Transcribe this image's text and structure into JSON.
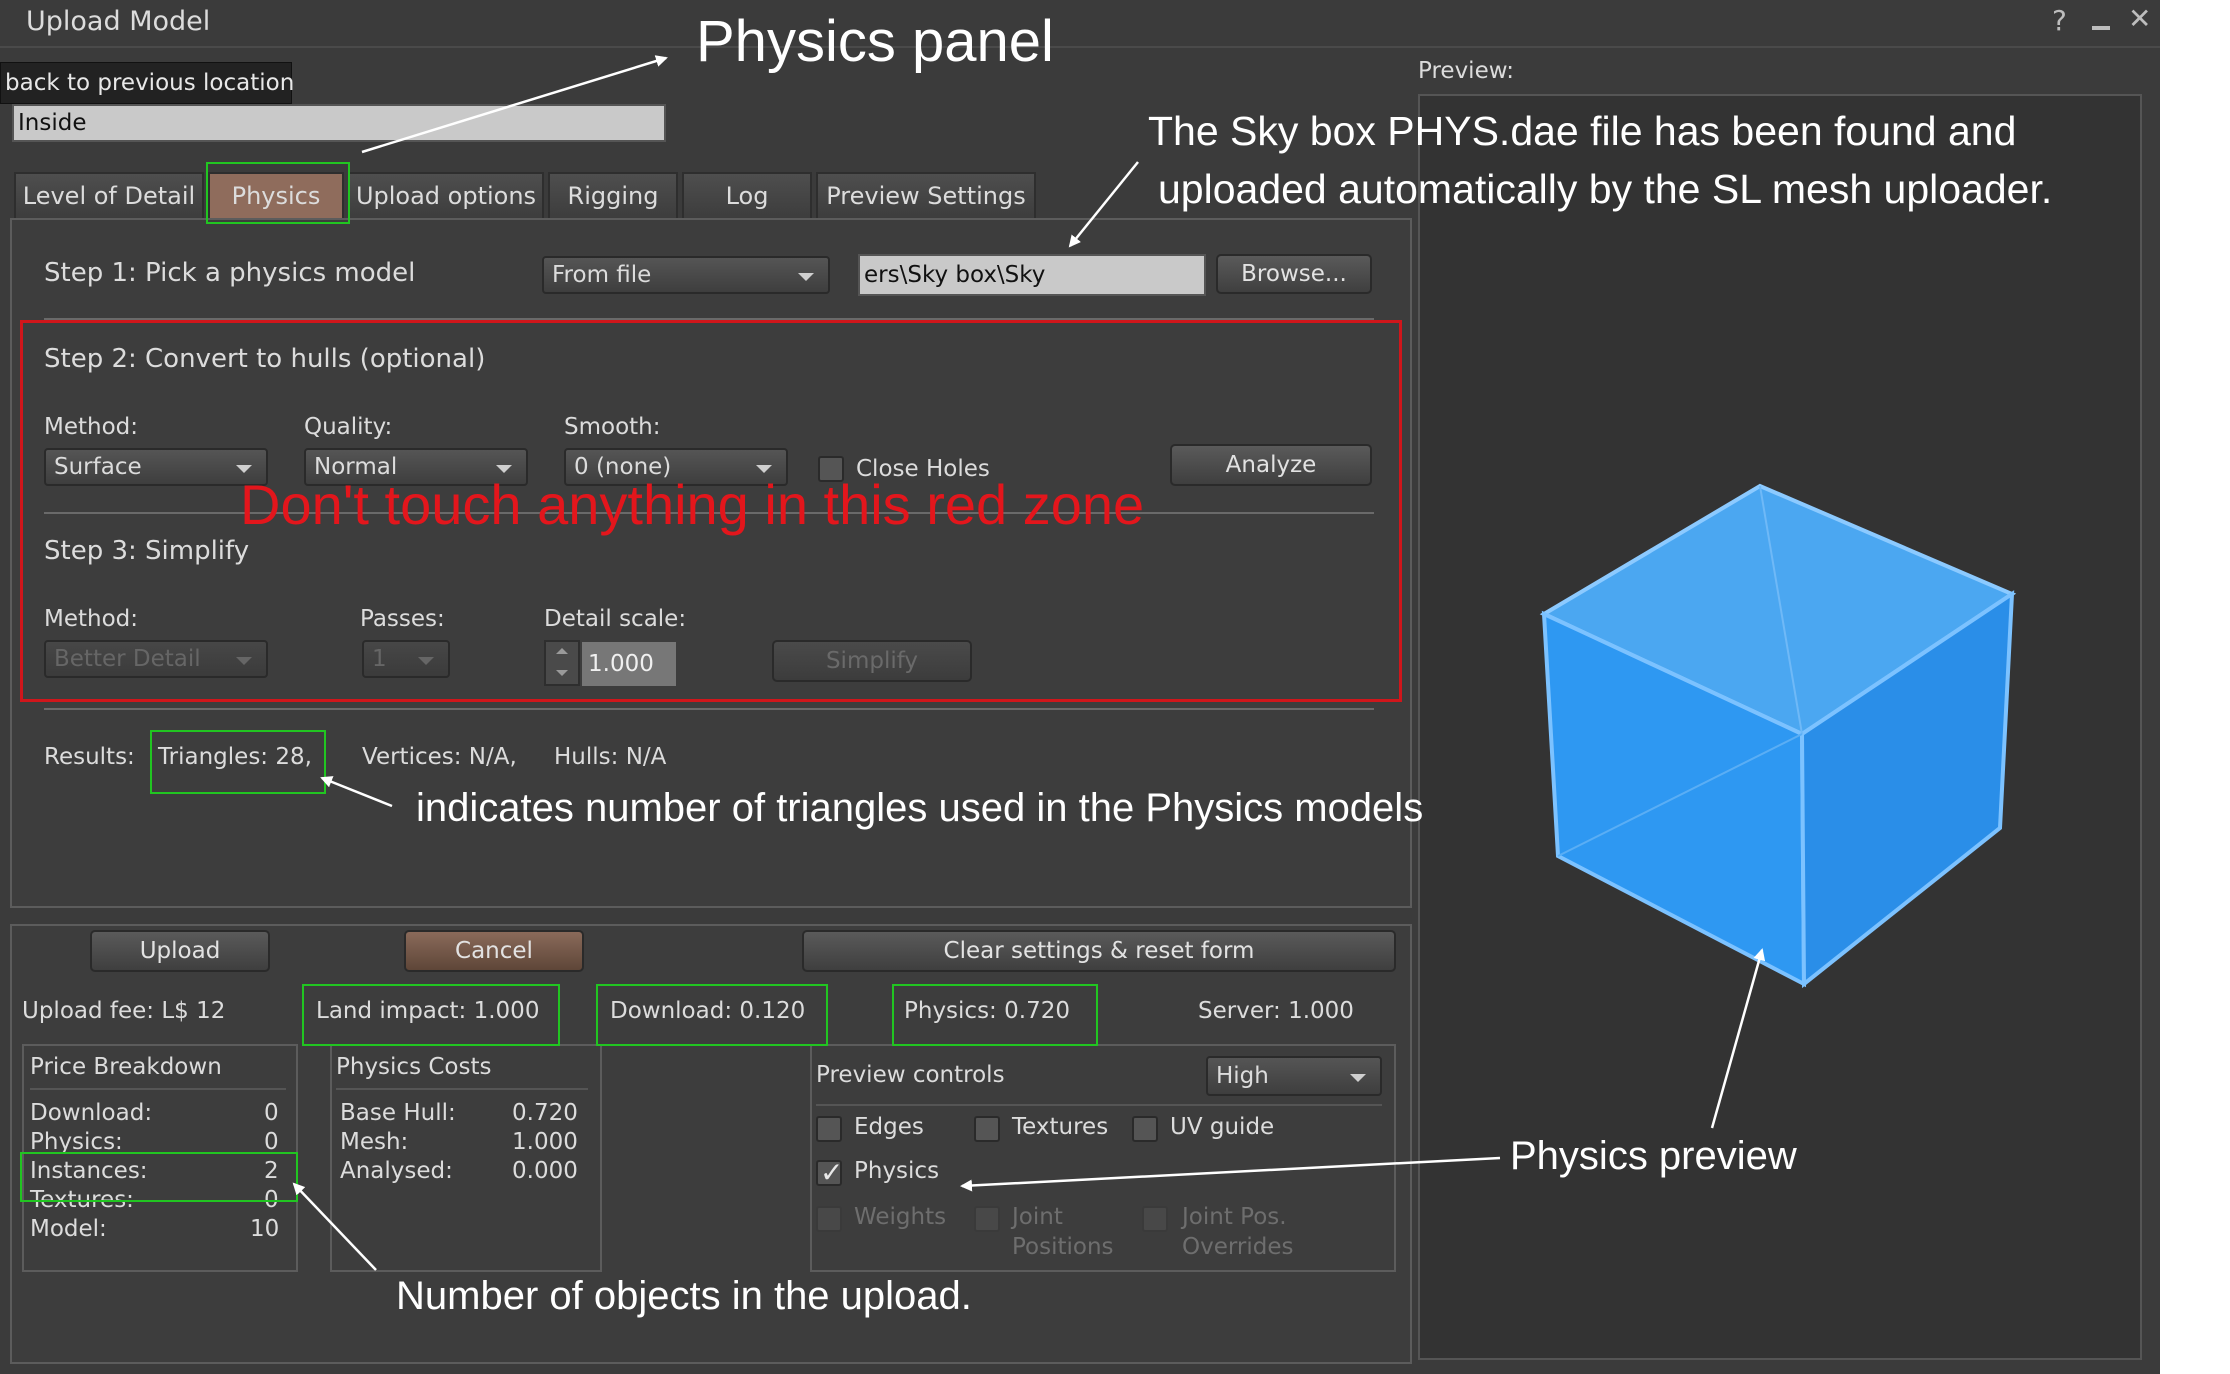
{
  "window": {
    "title": "Upload Model",
    "help_icon": "question-icon",
    "minimize_icon": "minimize-icon",
    "close_icon": "close-icon"
  },
  "tooltip": "back to previous location",
  "model_name": "Inside",
  "tabs": [
    {
      "label": "Level of Detail",
      "active": false
    },
    {
      "label": "Physics",
      "active": true
    },
    {
      "label": "Upload options",
      "active": false
    },
    {
      "label": "Rigging",
      "active": false
    },
    {
      "label": "Log",
      "active": false
    },
    {
      "label": "Preview Settings",
      "active": false
    }
  ],
  "step1": {
    "label": "Step 1: Pick a physics model",
    "source": "From file",
    "file_path": "ers\\Sky box\\Sky box_PHYS.dae",
    "browse_label": "Browse..."
  },
  "step2": {
    "label": "Step 2: Convert to hulls (optional)",
    "method_label": "Method:",
    "method_value": "Surface",
    "quality_label": "Quality:",
    "quality_value": "Normal",
    "smooth_label": "Smooth:",
    "smooth_value": "0 (none)",
    "close_holes_label": "Close Holes",
    "analyze_label": "Analyze"
  },
  "step3": {
    "label": "Step 3: Simplify",
    "method_label": "Method:",
    "method_value": "Better Detail",
    "passes_label": "Passes:",
    "passes_value": "1",
    "detail_scale_label": "Detail scale:",
    "detail_scale_value": "1.000",
    "simplify_label": "Simplify"
  },
  "results": {
    "label": "Results:",
    "triangles": "Triangles: 28,",
    "vertices": "Vertices: N/A,",
    "hulls": "Hulls: N/A"
  },
  "buttons": {
    "upload": "Upload",
    "cancel": "Cancel",
    "clear": "Clear settings & reset form"
  },
  "fees": {
    "upload_fee": "Upload fee: L$ 12",
    "land_impact": "Land impact: 1.000",
    "download": "Download: 0.120",
    "physics": "Physics: 0.720",
    "server": "Server: 1.000"
  },
  "price_breakdown": {
    "title": "Price Breakdown",
    "rows": [
      {
        "label": "Download:",
        "value": "0"
      },
      {
        "label": "Physics:",
        "value": "0"
      },
      {
        "label": "Instances:",
        "value": "2"
      },
      {
        "label": "Textures:",
        "value": "0"
      },
      {
        "label": "Model:",
        "value": "10"
      }
    ]
  },
  "physics_costs": {
    "title": "Physics Costs",
    "rows": [
      {
        "label": "Base Hull:",
        "value": "0.720"
      },
      {
        "label": "Mesh:",
        "value": "1.000"
      },
      {
        "label": "Analysed:",
        "value": "0.000"
      }
    ]
  },
  "preview_controls": {
    "title": "Preview controls",
    "quality": "High",
    "edges": "Edges",
    "textures": "Textures",
    "uv_guide": "UV guide",
    "physics": "Physics",
    "weights": "Weights",
    "joint_positions_1": "Joint",
    "joint_positions_2": "Positions",
    "joint_pos_overrides_1": "Joint Pos.",
    "joint_pos_overrides_2": "Overrides"
  },
  "preview": {
    "label": "Preview:"
  },
  "annotations": {
    "physics_panel": "Physics panel",
    "sky_box_1": "The Sky box  PHYS.dae file has been found and",
    "sky_box_2": "uploaded automatically by the SL mesh uploader.",
    "red_zone": "Don't touch anything in this red zone",
    "triangles_note": "indicates number of triangles used in the Physics models",
    "physics_preview": "Physics preview",
    "objects_note": "Number of objects in the upload."
  },
  "colors": {
    "window_bg": "#3b3b3b",
    "active_tab": "#8f6c5c",
    "highlight_green": "#21c521",
    "highlight_red": "#d0161b",
    "cube_blue": "#2f9bf0"
  }
}
